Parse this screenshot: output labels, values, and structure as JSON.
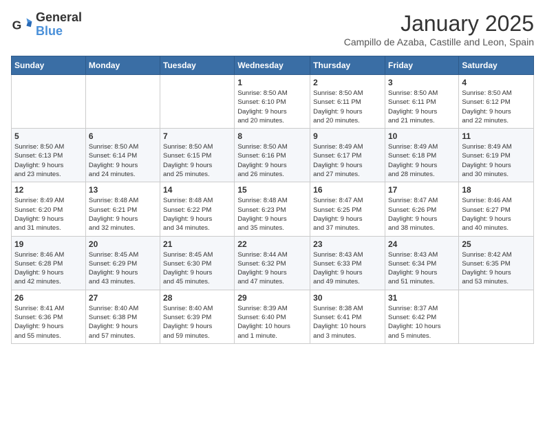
{
  "logo": {
    "general": "General",
    "blue": "Blue"
  },
  "title": {
    "month": "January 2025",
    "location": "Campillo de Azaba, Castille and Leon, Spain"
  },
  "headers": [
    "Sunday",
    "Monday",
    "Tuesday",
    "Wednesday",
    "Thursday",
    "Friday",
    "Saturday"
  ],
  "weeks": [
    [
      {
        "day": "",
        "info": ""
      },
      {
        "day": "",
        "info": ""
      },
      {
        "day": "",
        "info": ""
      },
      {
        "day": "1",
        "info": "Sunrise: 8:50 AM\nSunset: 6:10 PM\nDaylight: 9 hours\nand 20 minutes."
      },
      {
        "day": "2",
        "info": "Sunrise: 8:50 AM\nSunset: 6:11 PM\nDaylight: 9 hours\nand 20 minutes."
      },
      {
        "day": "3",
        "info": "Sunrise: 8:50 AM\nSunset: 6:11 PM\nDaylight: 9 hours\nand 21 minutes."
      },
      {
        "day": "4",
        "info": "Sunrise: 8:50 AM\nSunset: 6:12 PM\nDaylight: 9 hours\nand 22 minutes."
      }
    ],
    [
      {
        "day": "5",
        "info": "Sunrise: 8:50 AM\nSunset: 6:13 PM\nDaylight: 9 hours\nand 23 minutes."
      },
      {
        "day": "6",
        "info": "Sunrise: 8:50 AM\nSunset: 6:14 PM\nDaylight: 9 hours\nand 24 minutes."
      },
      {
        "day": "7",
        "info": "Sunrise: 8:50 AM\nSunset: 6:15 PM\nDaylight: 9 hours\nand 25 minutes."
      },
      {
        "day": "8",
        "info": "Sunrise: 8:50 AM\nSunset: 6:16 PM\nDaylight: 9 hours\nand 26 minutes."
      },
      {
        "day": "9",
        "info": "Sunrise: 8:49 AM\nSunset: 6:17 PM\nDaylight: 9 hours\nand 27 minutes."
      },
      {
        "day": "10",
        "info": "Sunrise: 8:49 AM\nSunset: 6:18 PM\nDaylight: 9 hours\nand 28 minutes."
      },
      {
        "day": "11",
        "info": "Sunrise: 8:49 AM\nSunset: 6:19 PM\nDaylight: 9 hours\nand 30 minutes."
      }
    ],
    [
      {
        "day": "12",
        "info": "Sunrise: 8:49 AM\nSunset: 6:20 PM\nDaylight: 9 hours\nand 31 minutes."
      },
      {
        "day": "13",
        "info": "Sunrise: 8:48 AM\nSunset: 6:21 PM\nDaylight: 9 hours\nand 32 minutes."
      },
      {
        "day": "14",
        "info": "Sunrise: 8:48 AM\nSunset: 6:22 PM\nDaylight: 9 hours\nand 34 minutes."
      },
      {
        "day": "15",
        "info": "Sunrise: 8:48 AM\nSunset: 6:23 PM\nDaylight: 9 hours\nand 35 minutes."
      },
      {
        "day": "16",
        "info": "Sunrise: 8:47 AM\nSunset: 6:25 PM\nDaylight: 9 hours\nand 37 minutes."
      },
      {
        "day": "17",
        "info": "Sunrise: 8:47 AM\nSunset: 6:26 PM\nDaylight: 9 hours\nand 38 minutes."
      },
      {
        "day": "18",
        "info": "Sunrise: 8:46 AM\nSunset: 6:27 PM\nDaylight: 9 hours\nand 40 minutes."
      }
    ],
    [
      {
        "day": "19",
        "info": "Sunrise: 8:46 AM\nSunset: 6:28 PM\nDaylight: 9 hours\nand 42 minutes."
      },
      {
        "day": "20",
        "info": "Sunrise: 8:45 AM\nSunset: 6:29 PM\nDaylight: 9 hours\nand 43 minutes."
      },
      {
        "day": "21",
        "info": "Sunrise: 8:45 AM\nSunset: 6:30 PM\nDaylight: 9 hours\nand 45 minutes."
      },
      {
        "day": "22",
        "info": "Sunrise: 8:44 AM\nSunset: 6:32 PM\nDaylight: 9 hours\nand 47 minutes."
      },
      {
        "day": "23",
        "info": "Sunrise: 8:43 AM\nSunset: 6:33 PM\nDaylight: 9 hours\nand 49 minutes."
      },
      {
        "day": "24",
        "info": "Sunrise: 8:43 AM\nSunset: 6:34 PM\nDaylight: 9 hours\nand 51 minutes."
      },
      {
        "day": "25",
        "info": "Sunrise: 8:42 AM\nSunset: 6:35 PM\nDaylight: 9 hours\nand 53 minutes."
      }
    ],
    [
      {
        "day": "26",
        "info": "Sunrise: 8:41 AM\nSunset: 6:36 PM\nDaylight: 9 hours\nand 55 minutes."
      },
      {
        "day": "27",
        "info": "Sunrise: 8:40 AM\nSunset: 6:38 PM\nDaylight: 9 hours\nand 57 minutes."
      },
      {
        "day": "28",
        "info": "Sunrise: 8:40 AM\nSunset: 6:39 PM\nDaylight: 9 hours\nand 59 minutes."
      },
      {
        "day": "29",
        "info": "Sunrise: 8:39 AM\nSunset: 6:40 PM\nDaylight: 10 hours\nand 1 minute."
      },
      {
        "day": "30",
        "info": "Sunrise: 8:38 AM\nSunset: 6:41 PM\nDaylight: 10 hours\nand 3 minutes."
      },
      {
        "day": "31",
        "info": "Sunrise: 8:37 AM\nSunset: 6:42 PM\nDaylight: 10 hours\nand 5 minutes."
      },
      {
        "day": "",
        "info": ""
      }
    ]
  ]
}
